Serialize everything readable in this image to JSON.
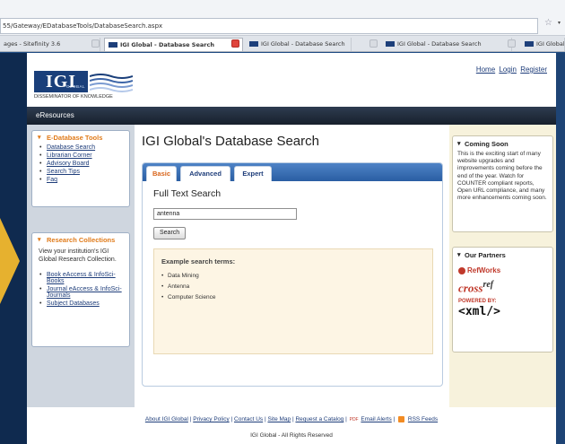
{
  "browser": {
    "url": "55/Gateway/EDatabaseTools/DatabaseSearch.aspx",
    "tabs": [
      {
        "label": "ages - Sitefinity 3.6",
        "active": false
      },
      {
        "label": "IGI Global - Database Search",
        "active": true
      },
      {
        "label": "IGI Global - Database Search",
        "active": false
      },
      {
        "label": "IGI Global - Database Search",
        "active": false
      },
      {
        "label": "IGI Global",
        "active": false
      }
    ]
  },
  "header": {
    "logo_text": "IGI",
    "logo_global": "GLOBAL",
    "logo_tagline": "DISSEMINATOR OF KNOWLEDGE",
    "links": {
      "home": "Home",
      "login": "Login",
      "register": "Register"
    }
  },
  "navbar": {
    "label": "eResources"
  },
  "left": {
    "tools": {
      "title": "E-Database Tools",
      "items": [
        "Database Search",
        "Librarian Corner",
        "Advisory Board",
        "Search Tips",
        "Faq"
      ]
    },
    "collections": {
      "title": "Research Collections",
      "description": "View your institution's IGI Global Research Collection.",
      "items": [
        "Book eAccess & InfoSci-Books",
        "Journal eAccess & InfoSci-Journals",
        "Subject Databases"
      ]
    }
  },
  "main": {
    "title": "IGI Global's Database Search",
    "tabs": [
      "Basic",
      "Advanced",
      "Expert"
    ],
    "section_title": "Full Text Search",
    "search_value": "antenna",
    "search_button": "Search",
    "examples": {
      "title": "Example search terms:",
      "items": [
        "Data Mining",
        "Antenna",
        "Computer Science"
      ]
    }
  },
  "right": {
    "coming_soon": {
      "title": "Coming Soon",
      "body": "This is the exciting start of many website upgrades and improvements coming before the end of the year. Watch for COUNTER compliant reports, Open URL compliance, and many more enhancements coming soon."
    },
    "partners": {
      "title": "Our Partners",
      "refworks": "RefWorks",
      "crossref": "cross",
      "crossref_sup": "ref",
      "powered_by": "POWERED BY:",
      "xml": "<xml/>"
    }
  },
  "footer": {
    "links": [
      "About IGI Global",
      "Privacy Policy",
      "Contact Us",
      "Site Map",
      "Request a Catalog",
      "Email Alerts",
      "RSS Feeds"
    ],
    "pdf_label": "PDF",
    "copyright": "IGI Global - All Rights Reserved"
  }
}
